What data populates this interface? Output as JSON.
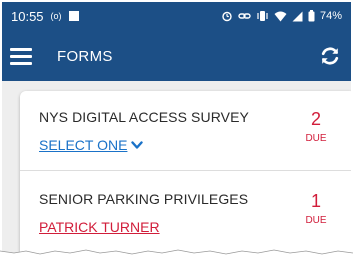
{
  "status_bar": {
    "time": "10:55",
    "radio": "(o)",
    "battery": "74%"
  },
  "toolbar": {
    "title": "FORMS"
  },
  "colors": {
    "header": "#1c4f86",
    "accent_blue": "#1a72c8",
    "accent_red": "#d11d3a"
  },
  "forms": [
    {
      "title": "NYS DIGITAL ACCESS SURVEY",
      "link": "SELECT ONE",
      "due_count": "2",
      "due_label": "DUE"
    },
    {
      "title": "SENIOR PARKING PRIVILEGES",
      "link": "PATRICK TURNER",
      "due_count": "1",
      "due_label": "DUE"
    }
  ],
  "icons": {
    "menu": "menu-icon",
    "refresh": "refresh-icon",
    "chevron": "chevron-down-icon"
  }
}
